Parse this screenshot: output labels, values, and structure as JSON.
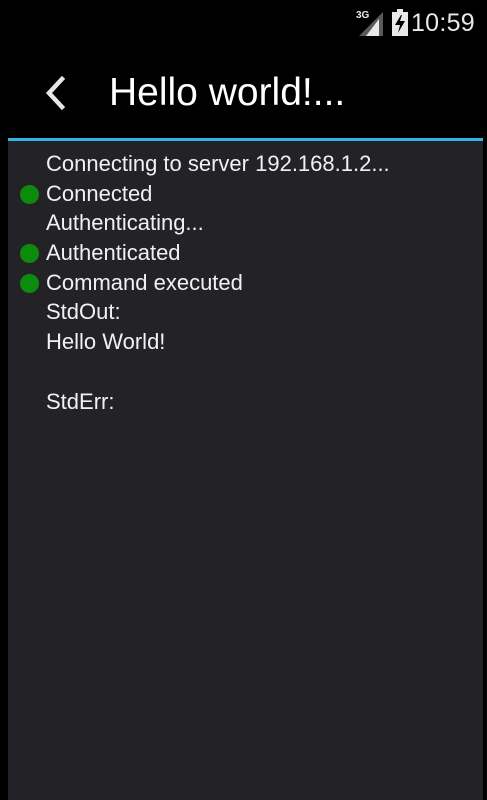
{
  "status_bar": {
    "network_type": "3G",
    "time": "10:59"
  },
  "action_bar": {
    "title": "Hello world!..."
  },
  "log": {
    "lines": [
      {
        "text": "Connecting to server 192.168.1.2...",
        "success": false
      },
      {
        "text": "Connected",
        "success": true
      },
      {
        "text": "Authenticating...",
        "success": false
      },
      {
        "text": "Authenticated",
        "success": true
      },
      {
        "text": "Command executed",
        "success": true
      },
      {
        "text": "StdOut:",
        "success": false
      },
      {
        "text": "Hello World!",
        "success": false
      },
      {
        "text": "",
        "success": false
      },
      {
        "text": "StdErr:",
        "success": false
      }
    ]
  },
  "colors": {
    "background": "#000000",
    "content_background": "#232327",
    "accent_divider": "#33b5e5",
    "success_dot": "#0c8c0c",
    "text": "#f1f1f1"
  },
  "icons": {
    "back": "chevron-left-icon",
    "signal": "signal-icon",
    "battery": "battery-charging-icon",
    "success": "status-dot-icon"
  }
}
